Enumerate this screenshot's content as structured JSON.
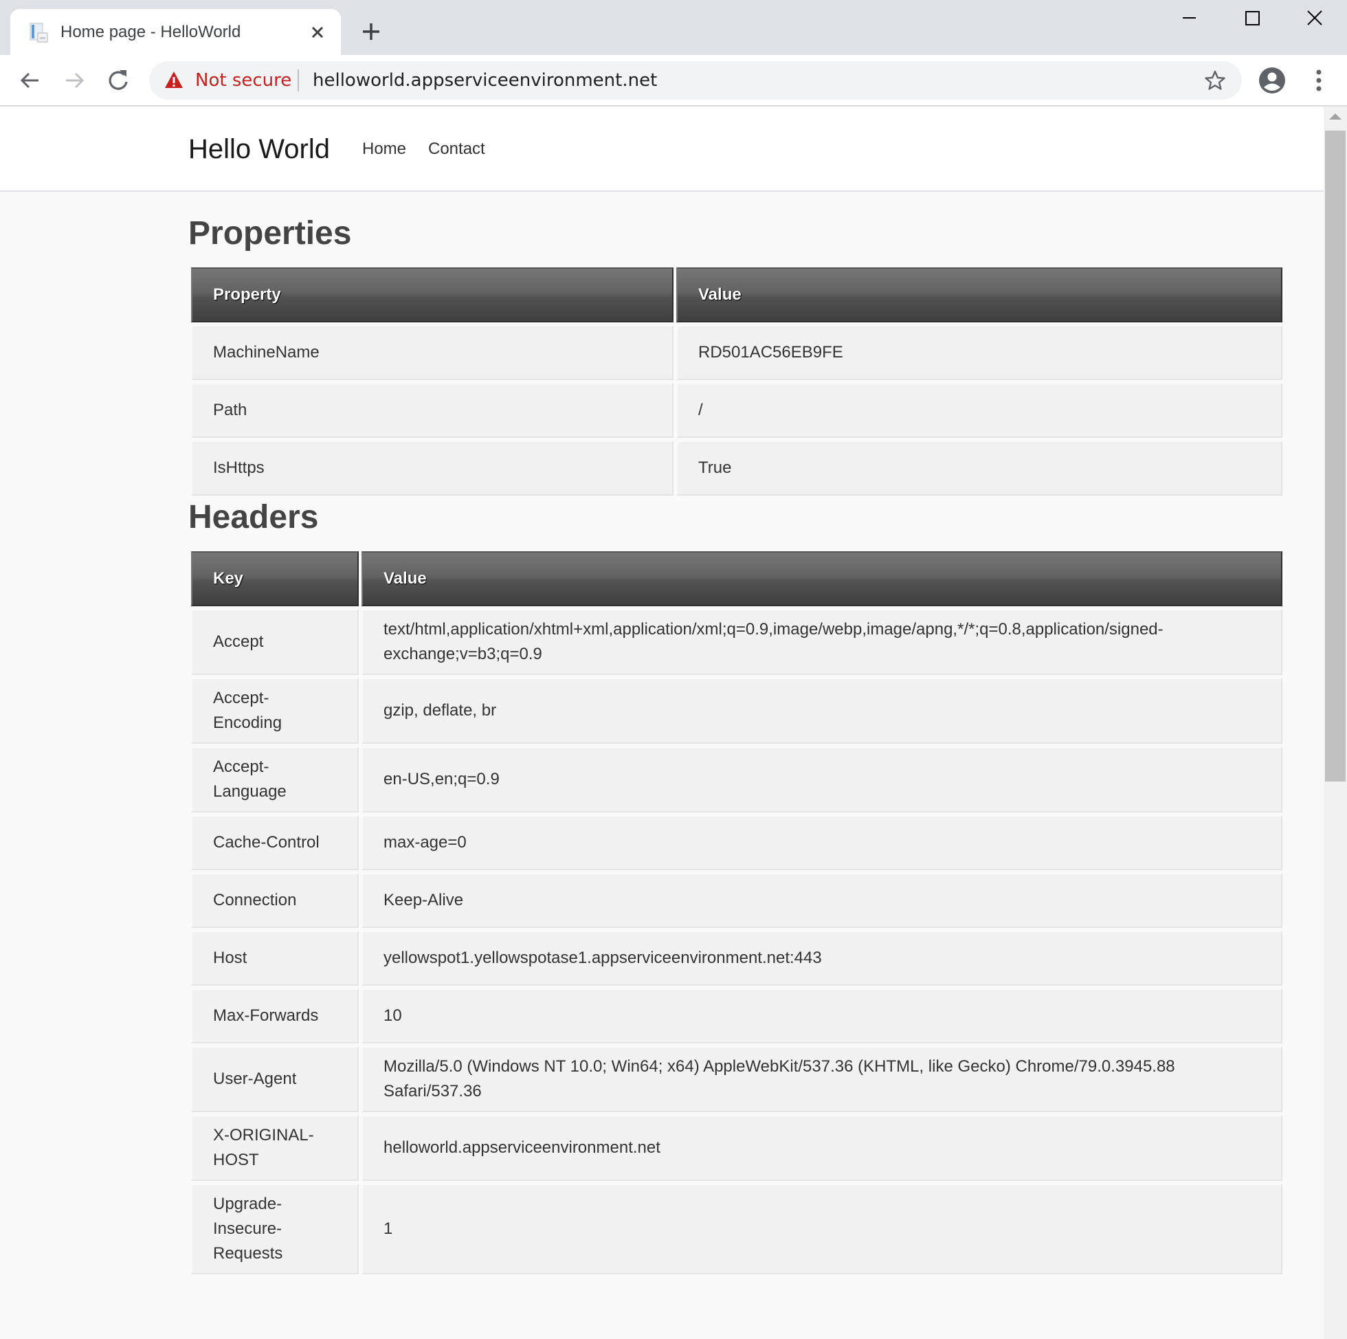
{
  "browser": {
    "tab": {
      "title": "Home page - HelloWorld",
      "favicon": "document-icon",
      "close_glyph": "✕"
    },
    "new_tab_icon": "plus-icon",
    "window_controls": [
      "minimize-icon",
      "maximize-icon",
      "close-icon"
    ],
    "toolbar": {
      "back_icon": "arrow-left-icon",
      "forward_icon": "arrow-right-icon",
      "reload_icon": "reload-icon",
      "security_label": "Not secure",
      "url": "helloworld.appserviceenvironment.net",
      "bookmark_icon": "star-icon",
      "profile_icon": "account-circle-icon",
      "menu_icon": "more-vert-icon"
    },
    "colors": {
      "warning": "#c5221f",
      "tabstrip": "#dee1e6"
    }
  },
  "site": {
    "brand": "Hello World",
    "nav": [
      {
        "label": "Home"
      },
      {
        "label": "Contact"
      }
    ]
  },
  "properties": {
    "title": "Properties",
    "columns": [
      "Property",
      "Value"
    ],
    "rows": [
      {
        "key": "MachineName",
        "value": "RD501AC56EB9FE"
      },
      {
        "key": "Path",
        "value": "/"
      },
      {
        "key": "IsHttps",
        "value": "True"
      }
    ]
  },
  "headers": {
    "title": "Headers",
    "columns": [
      "Key",
      "Value"
    ],
    "rows": [
      {
        "key": "Accept",
        "value": "text/html,application/xhtml+xml,application/xml;q=0.9,image/webp,image/apng,*/*;q=0.8,application/signed-exchange;v=b3;q=0.9"
      },
      {
        "key": "Accept-Encoding",
        "value": "gzip, deflate, br"
      },
      {
        "key": "Accept-Language",
        "value": "en-US,en;q=0.9"
      },
      {
        "key": "Cache-Control",
        "value": "max-age=0"
      },
      {
        "key": "Connection",
        "value": "Keep-Alive"
      },
      {
        "key": "Host",
        "value": "yellowspot1.yellowspotase1.appserviceenvironment.net:443"
      },
      {
        "key": "Max-Forwards",
        "value": "10"
      },
      {
        "key": "User-Agent",
        "value": "Mozilla/5.0 (Windows NT 10.0; Win64; x64) AppleWebKit/537.36 (KHTML, like Gecko) Chrome/79.0.3945.88 Safari/537.36"
      },
      {
        "key": "X-ORIGINAL-HOST",
        "value": "helloworld.appserviceenvironment.net"
      },
      {
        "key": "Upgrade-Insecure-Requests",
        "value": "1"
      }
    ]
  }
}
